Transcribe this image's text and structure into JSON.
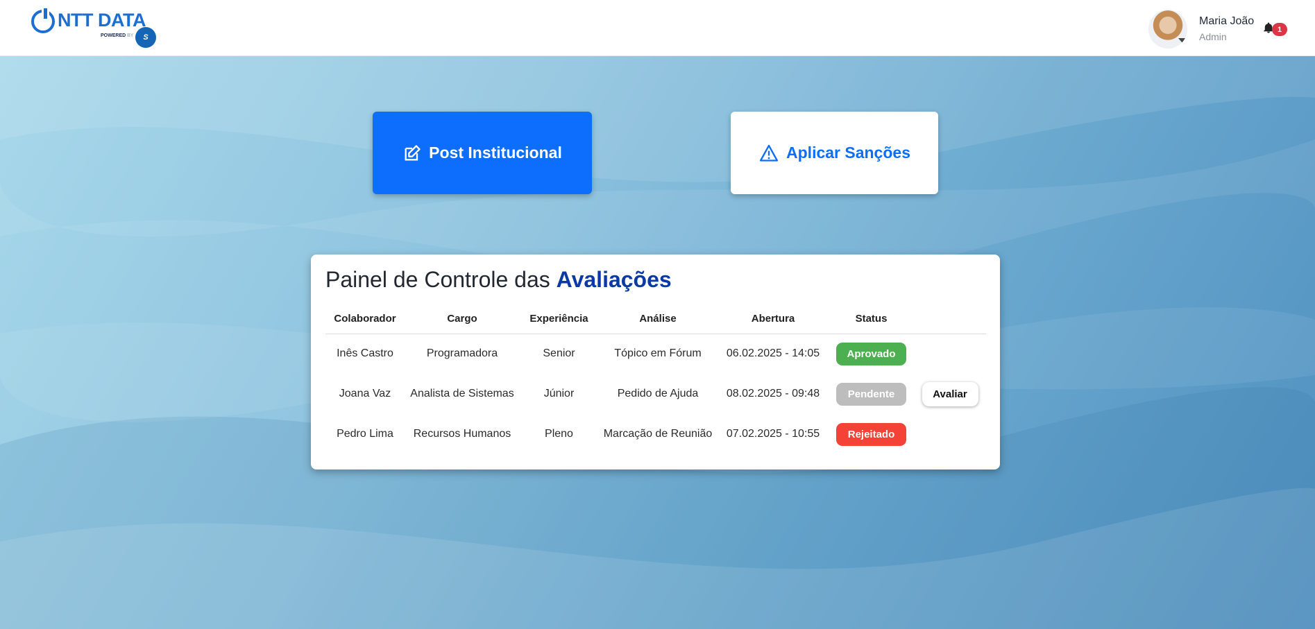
{
  "header": {
    "logo_text": "NTT DATA",
    "logo_powered_prefix": "POWERED",
    "logo_powered_by": "BY",
    "logo_badge": "S"
  },
  "user": {
    "name": "Maria João",
    "role": "Admin",
    "notification_count": "1"
  },
  "actions": {
    "post_label": "Post Institucional",
    "sancoes_label": "Aplicar Sanções"
  },
  "panel": {
    "title_prefix": "Painel de Controle das",
    "title_accent": "Avaliações",
    "columns": [
      "Colaborador",
      "Cargo",
      "Experiência",
      "Análise",
      "Abertura",
      "Status"
    ],
    "rows": [
      {
        "colaborador": "Inês Castro",
        "cargo": "Programadora",
        "experiencia": "Senior",
        "analise": "Tópico em Fórum",
        "abertura": "06.02.2025 - 14:05",
        "status": "Aprovado",
        "status_color": "#4caf50",
        "action": ""
      },
      {
        "colaborador": "Joana Vaz",
        "cargo": "Analista de Sistemas",
        "experiencia": "Júnior",
        "analise": "Pedido de Ajuda",
        "abertura": "08.02.2025 - 09:48",
        "status": "Pendente",
        "status_color": "#bdbdbd",
        "action": "Avaliar"
      },
      {
        "colaborador": "Pedro Lima",
        "cargo": "Recursos Humanos",
        "experiencia": "Pleno",
        "analise": "Marcação de Reunião",
        "abertura": "07.02.2025 - 10:55",
        "status": "Rejeitado",
        "status_color": "#f44336",
        "action": ""
      }
    ]
  },
  "colors": {
    "primary": "#0d6efd",
    "accent_title": "#0b3aa6",
    "notification": "#dc3545"
  }
}
